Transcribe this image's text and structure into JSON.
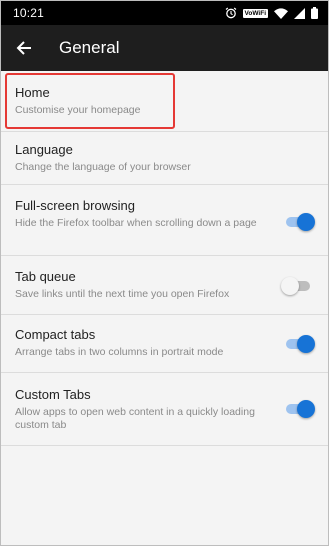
{
  "status_bar": {
    "time": "10:21",
    "vowifi_label": "VoWiFi",
    "icons": [
      "alarm-icon",
      "vowifi-badge",
      "wifi-icon",
      "signal-icon",
      "battery-icon"
    ]
  },
  "app_bar": {
    "title": "General",
    "back_icon": "back-arrow-icon"
  },
  "colors": {
    "accent": "#1773d6",
    "highlight": "#e53935",
    "app_bar_bg": "#1e1e1e"
  },
  "settings": [
    {
      "title": "Home",
      "summary": "Customise your homepage"
    },
    {
      "title": "Language",
      "summary": "Change the language of your browser"
    },
    {
      "title": "Full-screen browsing",
      "summary": "Hide the Firefox toolbar when scrolling down a page",
      "toggle": true
    },
    {
      "title": "Tab queue",
      "summary": "Save links until the next time you open Firefox",
      "toggle": false
    },
    {
      "title": "Compact tabs",
      "summary": "Arrange tabs in two columns in portrait mode",
      "toggle": true
    },
    {
      "title": "Custom Tabs",
      "summary": "Allow apps to open web content in a quickly loading custom tab",
      "toggle": true
    }
  ]
}
